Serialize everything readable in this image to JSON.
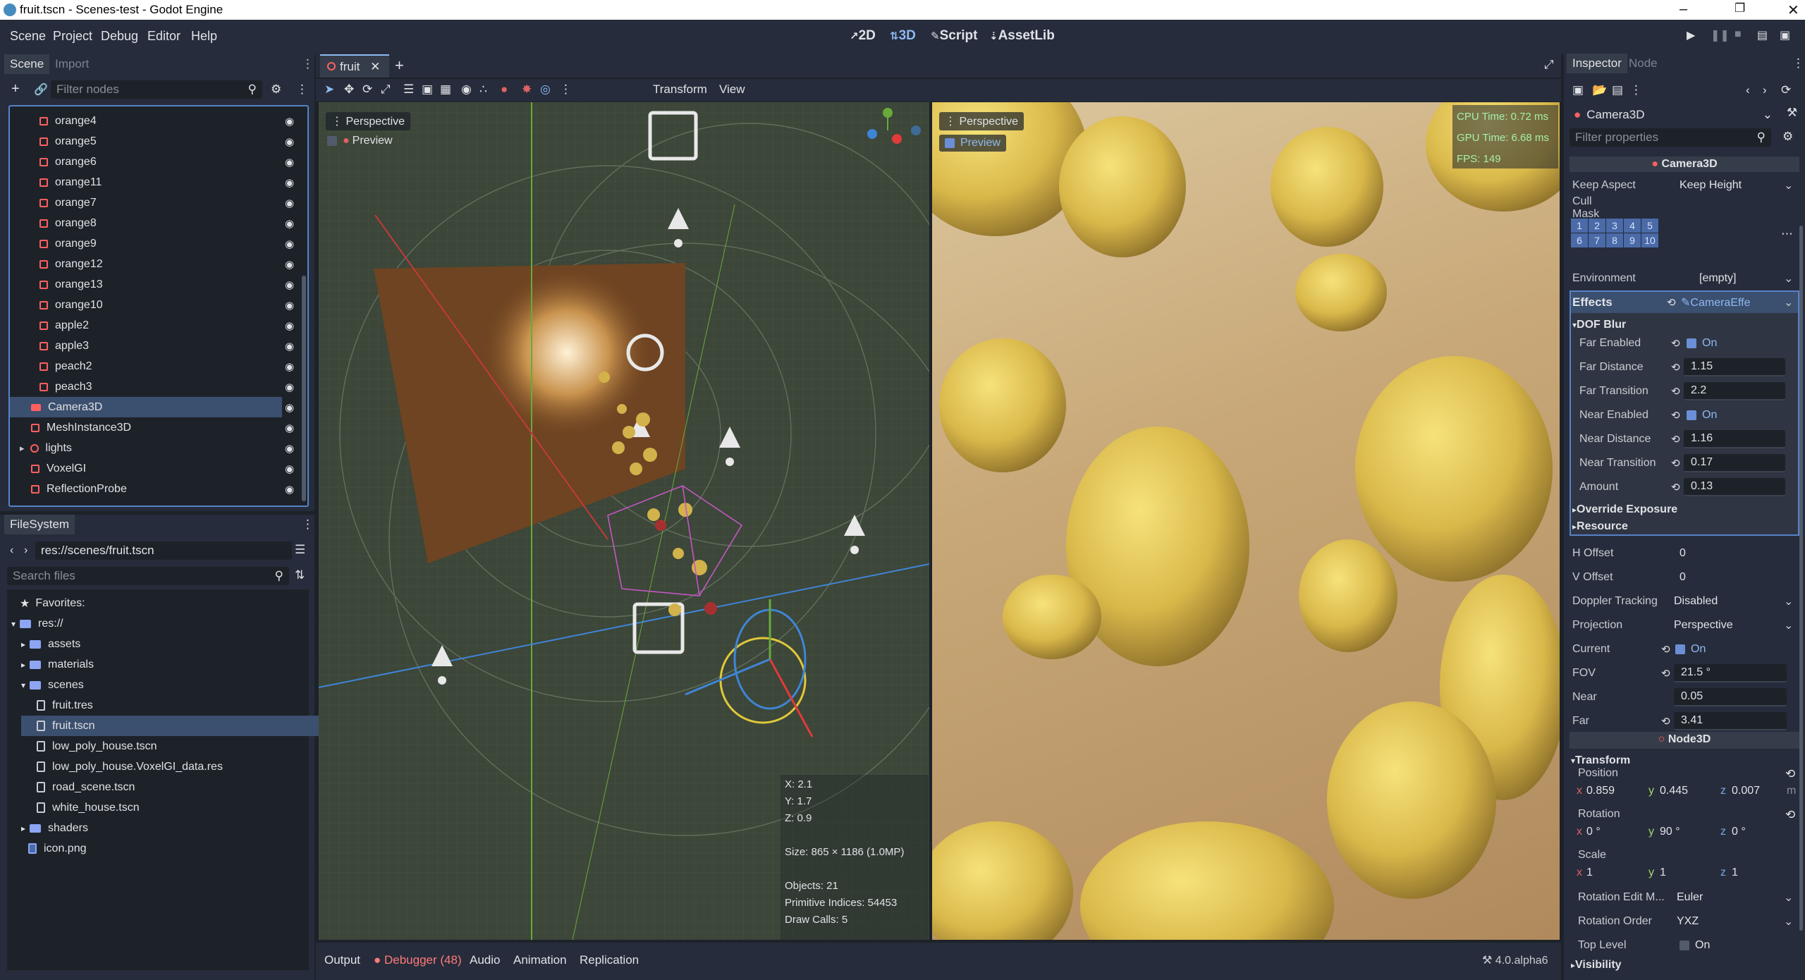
{
  "window": {
    "title": "fruit.tscn - Scenes-test - Godot Engine"
  },
  "menu": [
    "Scene",
    "Project",
    "Debug",
    "Editor",
    "Help"
  ],
  "workspaces": [
    {
      "label": "2D",
      "icon": "2d-icon"
    },
    {
      "label": "3D",
      "icon": "3d-icon"
    },
    {
      "label": "Script",
      "icon": "script-icon"
    },
    {
      "label": "AssetLib",
      "icon": "assetlib-icon"
    }
  ],
  "scene_dock": {
    "tabs": [
      "Scene",
      "Import"
    ],
    "filter_placeholder": "Filter nodes",
    "nodes": [
      "orange4",
      "orange5",
      "orange6",
      "orange11",
      "orange7",
      "orange8",
      "orange9",
      "orange12",
      "orange13",
      "orange10",
      "apple2",
      "apple3",
      "peach2",
      "peach3"
    ],
    "root_children": [
      "Camera3D",
      "MeshInstance3D",
      "lights",
      "VoxelGI",
      "ReflectionProbe"
    ],
    "selected": "Camera3D"
  },
  "filesystem": {
    "title": "FileSystem",
    "path": "res://scenes/fruit.tscn",
    "search_placeholder": "Search files",
    "favorites": "Favorites:",
    "root": "res://",
    "folders": [
      "assets",
      "materials",
      "scenes"
    ],
    "scene_files": [
      "fruit.tres",
      "fruit.tscn",
      "low_poly_house.tscn",
      "low_poly_house.VoxelGI_data.res",
      "road_scene.tscn",
      "white_house.tscn"
    ],
    "shaders": "shaders",
    "icon": "icon.png"
  },
  "editor_tabs": {
    "current": "fruit"
  },
  "viewport_toolbar": {
    "transform": "Transform",
    "view": "View"
  },
  "viewport_left": {
    "label": "Perspective",
    "preview": "Preview",
    "stats": {
      "x": "X: 2.1",
      "y": "Y: 1.7",
      "z": "Z: 0.9",
      "size": "Size: 865 × 1186 (1.0MP)",
      "objects": "Objects: 21",
      "indices": "Primitive Indices: 54453",
      "draws": "Draw Calls: 5"
    }
  },
  "viewport_right": {
    "label": "Perspective",
    "preview": "Preview",
    "cpu": "CPU Time: 0.72 ms",
    "gpu": "GPU Time: 6.68 ms",
    "fps": "FPS: 149"
  },
  "bottom": {
    "tabs": [
      "Output",
      "Debugger (48)",
      "Audio",
      "Animation",
      "Replication"
    ],
    "version": "4.0.alpha6"
  },
  "inspector": {
    "tabs": [
      "Inspector",
      "Node"
    ],
    "object": "Camera3D",
    "filter_placeholder": "Filter properties",
    "class_header": "Camera3D",
    "keep_aspect": {
      "label": "Keep Aspect",
      "value": "Keep Height"
    },
    "cull_mask": {
      "label": "Cull Mask",
      "layers": [
        "1",
        "2",
        "3",
        "4",
        "5",
        "6",
        "7",
        "8",
        "9",
        "10"
      ]
    },
    "environment": {
      "label": "Environment",
      "value": "[empty]"
    },
    "effects": {
      "label": "Effects",
      "value": "CameraEffe"
    },
    "dof": {
      "title": "DOF Blur",
      "rows": [
        {
          "label": "Far Enabled",
          "value": "On",
          "check": true
        },
        {
          "label": "Far Distance",
          "value": "1.15"
        },
        {
          "label": "Far Transition",
          "value": "2.2"
        },
        {
          "label": "Near Enabled",
          "value": "On",
          "check": true
        },
        {
          "label": "Near Distance",
          "value": "1.16"
        },
        {
          "label": "Near Transition",
          "value": "0.17"
        },
        {
          "label": "Amount",
          "value": "0.13"
        }
      ],
      "override": "Override Exposure",
      "resource": "Resource"
    },
    "props": [
      {
        "label": "H Offset",
        "value": "0"
      },
      {
        "label": "V Offset",
        "value": "0"
      },
      {
        "label": "Doppler Tracking",
        "value": "Disabled"
      },
      {
        "label": "Projection",
        "value": "Perspective"
      }
    ],
    "current": {
      "label": "Current",
      "value": "On"
    },
    "fov": {
      "label": "FOV",
      "value": "21.5 °"
    },
    "near": {
      "label": "Near",
      "value": "0.05"
    },
    "far": {
      "label": "Far",
      "value": "3.41"
    },
    "node3d": "Node3D",
    "transform": {
      "title": "Transform",
      "position": {
        "label": "Position",
        "x": "0.859",
        "y": "0.445",
        "z": "0.007",
        "unit": "m"
      },
      "rotation": {
        "label": "Rotation",
        "x": "0 °",
        "y": "90 °",
        "z": "0 °"
      },
      "scale": {
        "label": "Scale",
        "x": "1",
        "y": "1",
        "z": "1"
      },
      "rotation_edit": {
        "label": "Rotation Edit M...",
        "value": "Euler"
      },
      "rotation_order": {
        "label": "Rotation Order",
        "value": "YXZ"
      },
      "top_level": {
        "label": "Top Level",
        "value": "On"
      },
      "visibility": "Visibility"
    }
  }
}
